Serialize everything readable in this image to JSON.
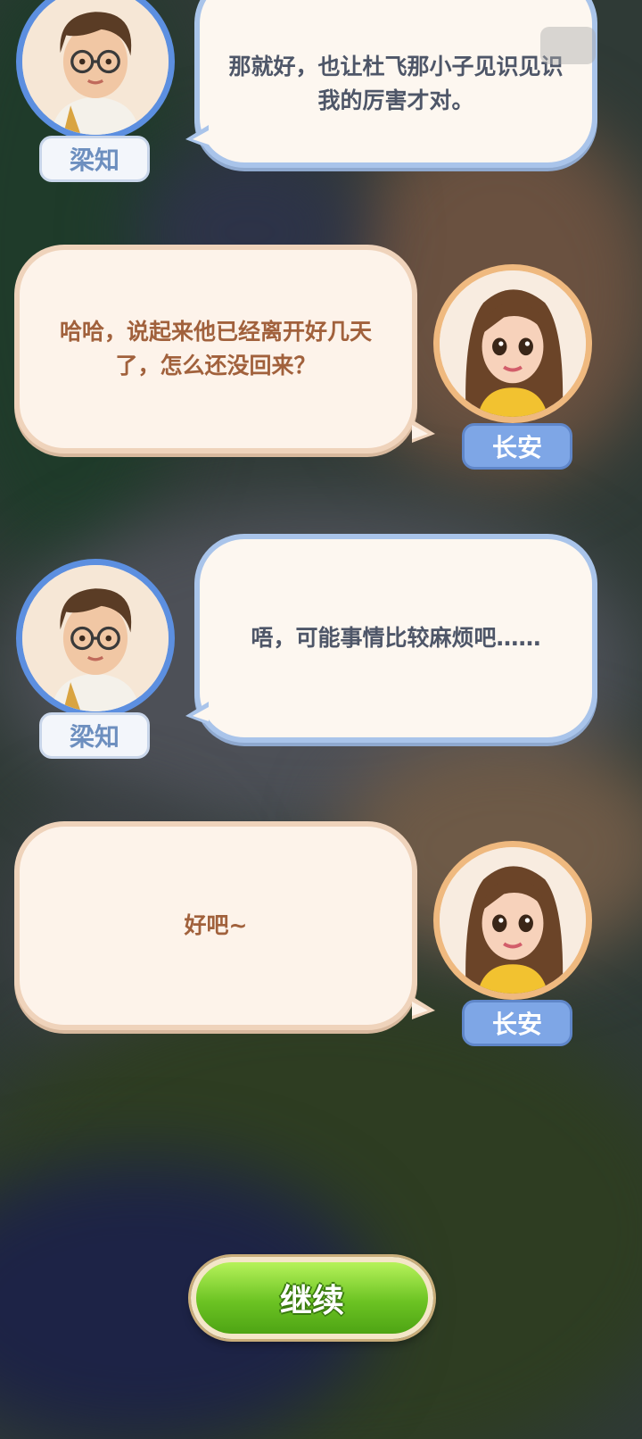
{
  "dialogue": [
    {
      "speaker": "梁知",
      "text": "那就好，也让杜飞那小子见识见识我的厉害才对。",
      "side": "left"
    },
    {
      "speaker": "长安",
      "text": "哈哈，说起来他已经离开好几天了，怎么还没回来？",
      "side": "right"
    },
    {
      "speaker": "梁知",
      "text": "唔，可能事情比较麻烦吧……",
      "side": "left"
    },
    {
      "speaker": "长安",
      "text": "好吧~",
      "side": "right"
    }
  ],
  "continue_label": "继续",
  "colors": {
    "left_bubble_border": "#a9c4ea",
    "right_bubble_border": "#efd3bb",
    "left_text": "#4e5668",
    "right_text": "#a1613c",
    "button_green": "#6cc323"
  },
  "icons": {
    "male_avatar": "boy-with-glasses-avatar",
    "female_avatar": "girl-long-hair-avatar"
  }
}
